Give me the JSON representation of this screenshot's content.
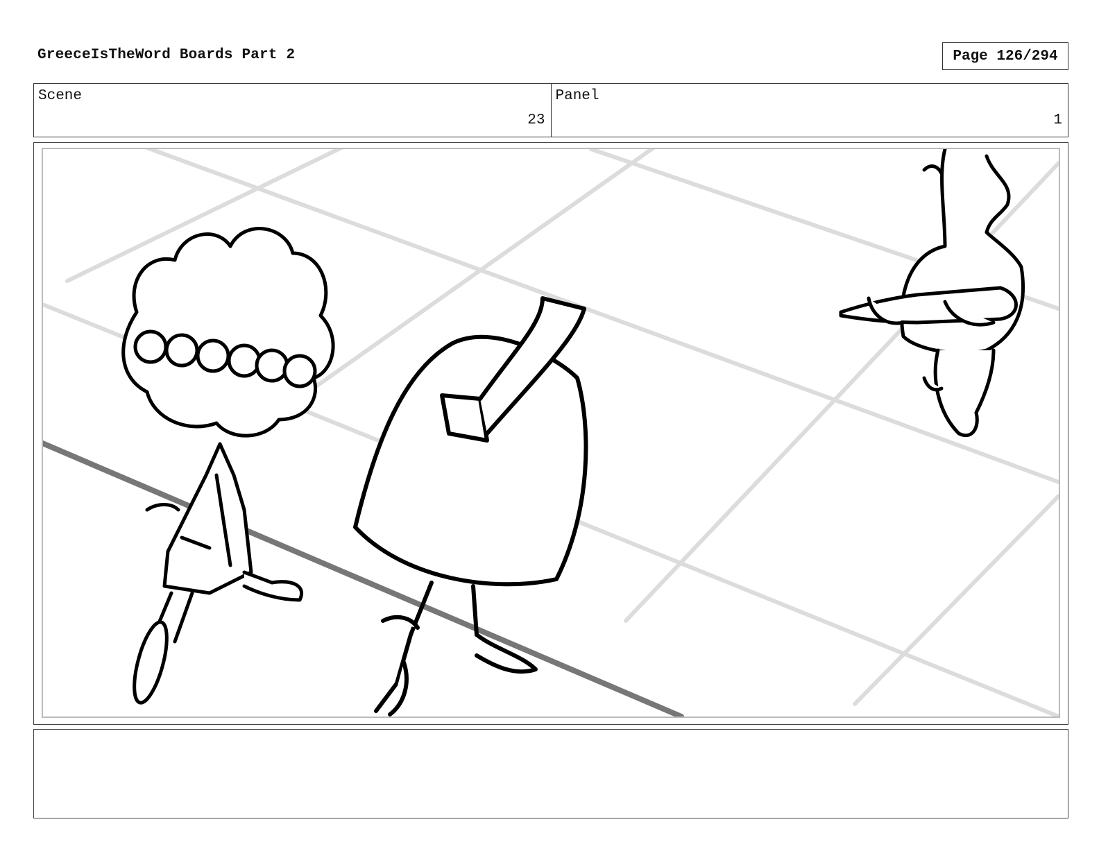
{
  "header": {
    "title": "GreeceIsTheWord Boards Part 2",
    "page": "Page 126/294"
  },
  "info": {
    "scene_label": "Scene",
    "scene_value": "23",
    "panel_label": "Panel",
    "panel_value": "1"
  },
  "panel_image": {
    "description_icons": [
      "curly-haired-character",
      "tall-hat-character",
      "character-holding-bread",
      "floor-tile-grid"
    ]
  },
  "notes": {
    "text": ""
  }
}
